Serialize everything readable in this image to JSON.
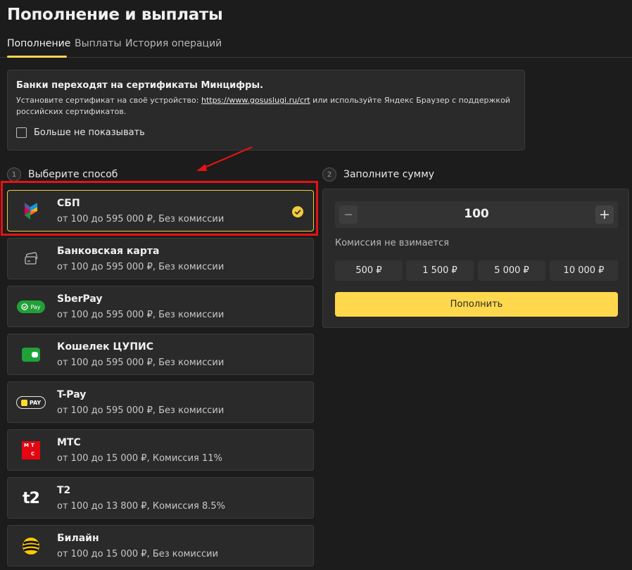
{
  "page": {
    "title": "Пополнение и выплаты",
    "tabs": [
      {
        "label": "Пополнение"
      },
      {
        "label": "Выплаты"
      },
      {
        "label": "История операций"
      }
    ]
  },
  "notice": {
    "title": "Банки переходят на сертификаты Минцифры.",
    "text_before": "Установите сертификат на своё устройство: ",
    "link": "https://www.gosuslugi.ru/crt",
    "text_after": " или используйте Яндекс Браузер с поддержкой российских сертификатов.",
    "checkbox_label": "Больше не показывать"
  },
  "steps": {
    "method": {
      "num": "1",
      "label": "Выберите способ"
    },
    "amount": {
      "num": "2",
      "label": "Заполните сумму"
    }
  },
  "methods": [
    {
      "name": "СБП",
      "desc": "от 100 до 595 000 ₽, Без комиссии",
      "icon": "sbp-icon",
      "selected": true
    },
    {
      "name": "Банковская карта",
      "desc": "от 100 до 595 000 ₽, Без комиссии",
      "icon": "card-icon"
    },
    {
      "name": "SberPay",
      "desc": "от 100 до 595 000 ₽, Без комиссии",
      "icon": "sberpay-icon",
      "icon_text": "Pay"
    },
    {
      "name": "Кошелек ЦУПИС",
      "desc": "от 100 до 595 000 ₽, Без комиссии",
      "icon": "wallet-icon"
    },
    {
      "name": "T-Pay",
      "desc": "от 100 до 595 000 ₽, Без комиссии",
      "icon": "tpay-icon",
      "icon_text": "PAY"
    },
    {
      "name": "МТС",
      "desc": "от 100 до 15 000 ₽, Комиссия 11%",
      "icon": "mts-icon",
      "icon_text": [
        "М",
        "Т",
        "С"
      ]
    },
    {
      "name": "T2",
      "desc": "от 100 до 13 800 ₽, Комиссия 8.5%",
      "icon": "t2-icon",
      "icon_text": "t2"
    },
    {
      "name": "Билайн",
      "desc": "от 100 до 15 000 ₽, Без комиссии",
      "icon": "beeline-icon"
    }
  ],
  "amount": {
    "value": "100",
    "minus_icon": "minus-icon",
    "plus_icon": "plus-icon",
    "commission": "Комиссия не взимается",
    "presets": [
      "500 ₽",
      "1 500 ₽",
      "5 000 ₽",
      "10 000 ₽"
    ],
    "submit_label": "Пополнить"
  },
  "colors": {
    "accent": "#ffd84d",
    "background": "#1c1c1c",
    "panel": "#2a2a2a",
    "highlight": "#e31313"
  }
}
